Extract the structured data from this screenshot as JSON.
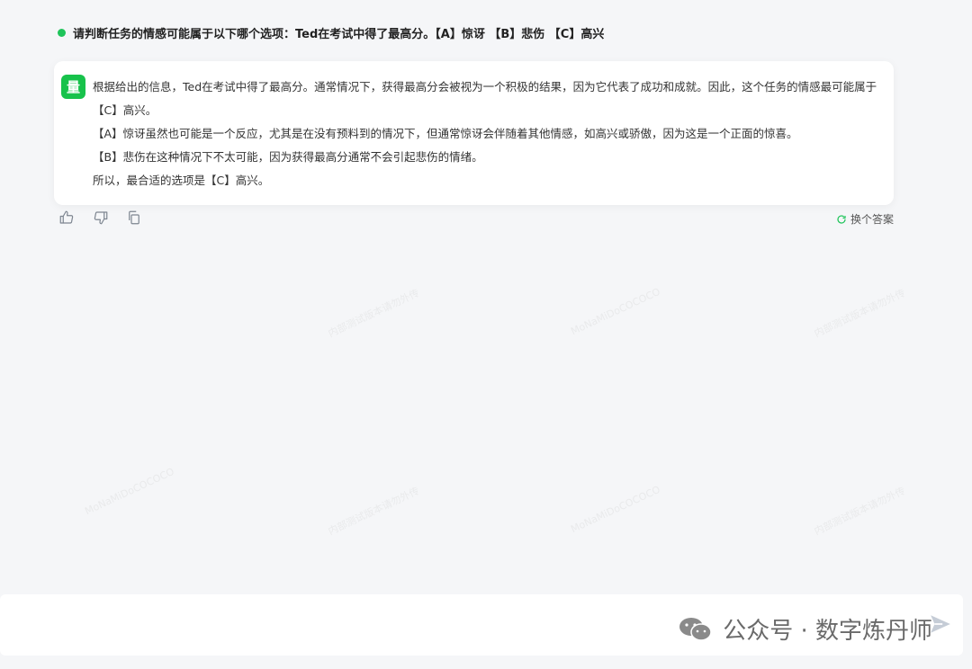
{
  "question": {
    "text": "请判断任务的情感可能属于以下哪个选项：Ted在考试中得了最高分。【A】惊讶 【B】悲伤 【C】高兴"
  },
  "answer": {
    "avatar_label": "量",
    "paragraphs": [
      "根据给出的信息，Ted在考试中得了最高分。通常情况下，获得最高分会被视为一个积极的结果，因为它代表了成功和成就。因此，这个任务的情感最可能属于【C】高兴。",
      "【A】惊讶虽然也可能是一个反应，尤其是在没有预料到的情况下，但通常惊讶会伴随着其他情感，如高兴或骄傲，因为这是一个正面的惊喜。",
      "【B】悲伤在这种情况下不太可能，因为获得最高分通常不会引起悲伤的情绪。",
      "所以，最合适的选项是【C】高兴。"
    ]
  },
  "feedback": {
    "like_icon": "thumbs-up-icon",
    "dislike_icon": "thumbs-down-icon",
    "copy_icon": "copy-icon",
    "regenerate_label": "换个答案"
  },
  "footer": {
    "account_label": "公众号 · 数字炼丹师"
  },
  "watermark": {
    "line1": "MoNaMiDoCOCOCO",
    "line2": "内部测试版本请勿外传"
  },
  "colors": {
    "accent_green": "#1fc45a",
    "avatar_green": "#17c24b",
    "background": "#f5f6f8"
  }
}
